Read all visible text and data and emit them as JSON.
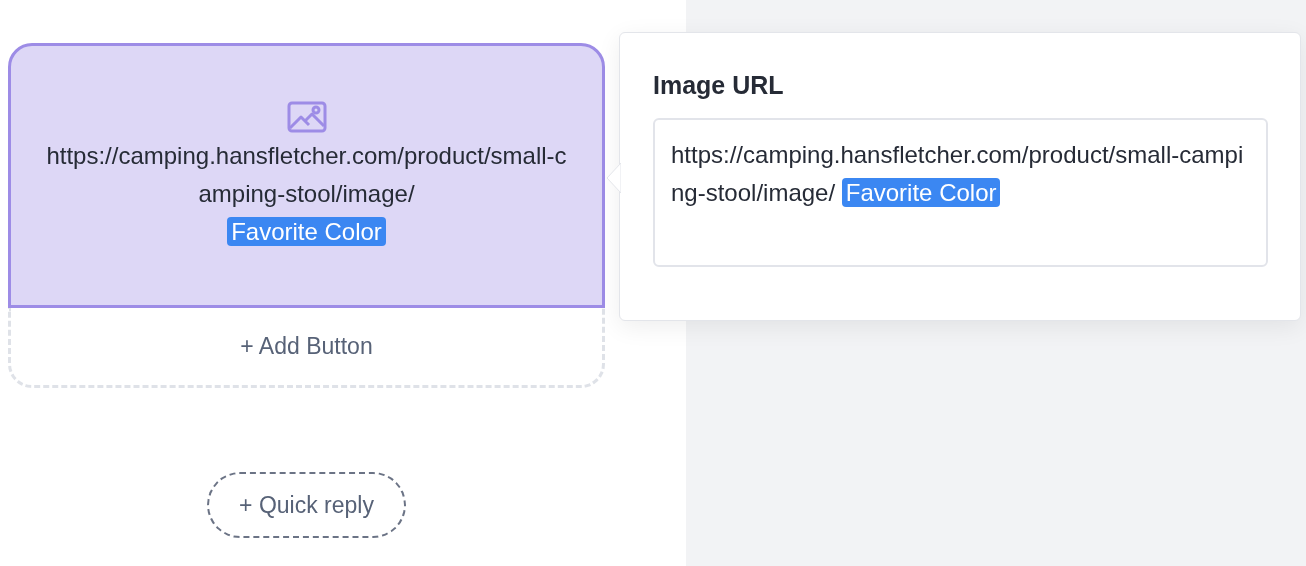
{
  "message_card": {
    "kind": "image",
    "selected": true,
    "url_text": "https://camping.hansfletcher.com/product/small-camping-stool/image/",
    "variable": "Favorite Color"
  },
  "add_button": "+ Add Button",
  "quick_reply": "+ Quick reply",
  "popover": {
    "title": "Image URL",
    "field": {
      "url_text": "https://camping.hansfletcher.com/product/small-camping-stool/image/",
      "variable": "Favorite Color"
    }
  }
}
